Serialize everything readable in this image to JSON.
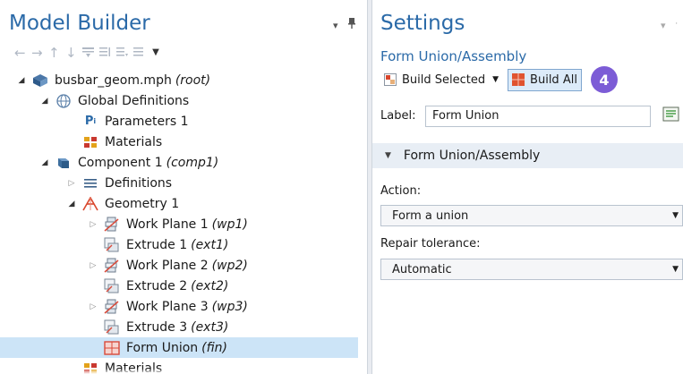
{
  "left": {
    "title": "Model Builder",
    "tree": [
      {
        "label": "busbar_geom.mph",
        "tag": "(root)",
        "icon": "model-file-icon",
        "arrow": "open"
      },
      {
        "label": "Global Definitions",
        "tag": "",
        "icon": "globe-icon",
        "arrow": "open"
      },
      {
        "label": "Parameters 1",
        "tag": "",
        "icon": "parameters-icon",
        "arrow": ""
      },
      {
        "label": "Materials",
        "tag": "",
        "icon": "materials-icon",
        "arrow": ""
      },
      {
        "label": "Component 1",
        "tag": "(comp1)",
        "icon": "component-icon",
        "arrow": "open"
      },
      {
        "label": "Definitions",
        "tag": "",
        "icon": "definitions-icon",
        "arrow": "closed"
      },
      {
        "label": "Geometry 1",
        "tag": "",
        "icon": "geometry-icon",
        "arrow": "open"
      },
      {
        "label": "Work Plane 1",
        "tag": "(wp1)",
        "icon": "work-plane-icon",
        "arrow": "closed"
      },
      {
        "label": "Extrude 1",
        "tag": "(ext1)",
        "icon": "extrude-icon",
        "arrow": ""
      },
      {
        "label": "Work Plane 2",
        "tag": "(wp2)",
        "icon": "work-plane-icon",
        "arrow": "closed"
      },
      {
        "label": "Extrude 2",
        "tag": "(ext2)",
        "icon": "extrude-icon",
        "arrow": ""
      },
      {
        "label": "Work Plane 3",
        "tag": "(wp3)",
        "icon": "work-plane-icon",
        "arrow": "closed"
      },
      {
        "label": "Extrude 3",
        "tag": "(ext3)",
        "icon": "extrude-icon",
        "arrow": ""
      },
      {
        "label": "Form Union",
        "tag": "(fin)",
        "icon": "form-union-icon",
        "arrow": "",
        "selected": true
      },
      {
        "label": "Materials",
        "tag": "",
        "icon": "materials-icon",
        "arrow": ""
      }
    ]
  },
  "right": {
    "title": "Settings",
    "subtitle": "Form Union/Assembly",
    "build_selected": "Build Selected",
    "build_all": "Build All",
    "badge": "4",
    "label_caption": "Label:",
    "label_value": "Form Union",
    "section_title": "Form Union/Assembly",
    "action_caption": "Action:",
    "action_value": "Form a union",
    "repair_caption": "Repair tolerance:",
    "repair_value": "Automatic"
  },
  "colors": {
    "title_blue": "#2b6aa8",
    "selection": "#cce4f7",
    "badge": "#7c5cd6",
    "section_bg": "#e8eef5"
  }
}
